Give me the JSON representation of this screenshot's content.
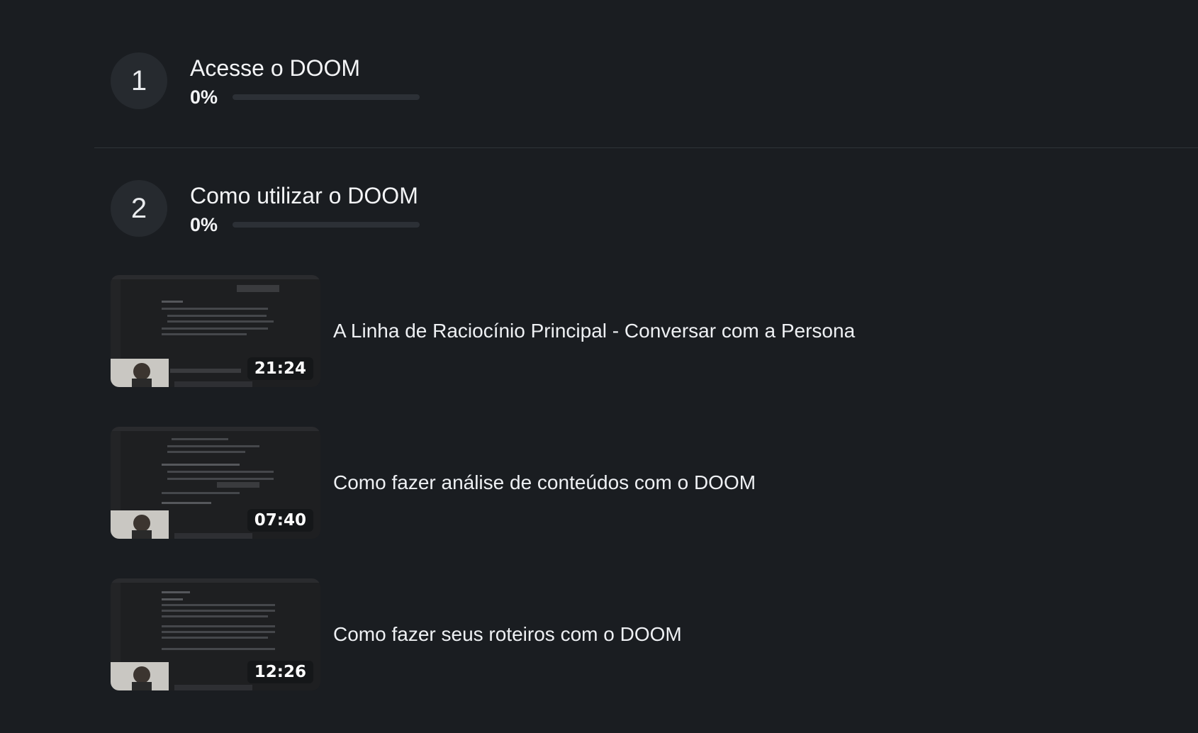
{
  "modules": [
    {
      "number": "1",
      "title": "Acesse o DOOM",
      "progress_label": "0%",
      "progress": 0
    },
    {
      "number": "2",
      "title": "Como utilizar o DOOM",
      "progress_label": "0%",
      "progress": 0
    }
  ],
  "lessons": [
    {
      "title": "A Linha de Raciocínio Principal - Conversar com a Persona",
      "duration": "21:24"
    },
    {
      "title": "Como fazer análise de conteúdos com o DOOM",
      "duration": "07:40"
    },
    {
      "title": "Como fazer seus roteiros com o DOOM",
      "duration": "12:26"
    }
  ],
  "colors": {
    "background": "#1a1d21",
    "circle": "#262a2f",
    "progress_track": "#2c3036",
    "text": "#f3f4f6"
  }
}
